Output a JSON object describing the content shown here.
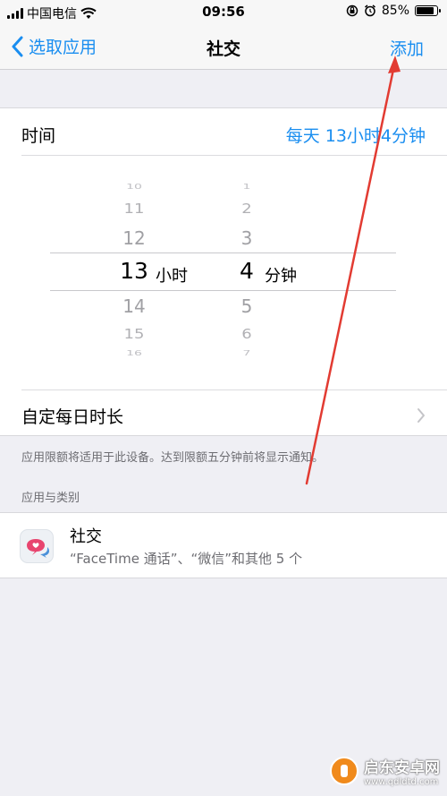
{
  "status_bar": {
    "carrier": "中国电信",
    "time": "09:56",
    "battery_text": "85%",
    "battery_level": 0.85
  },
  "nav": {
    "back_label": "选取应用",
    "title": "社交",
    "action_label": "添加"
  },
  "time_section": {
    "label": "时间",
    "value": "每天 13小时4分钟",
    "picker": {
      "hours": [
        "10",
        "11",
        "12",
        "13",
        "14",
        "15",
        "16"
      ],
      "minutes": [
        "1",
        "2",
        "3",
        "4",
        "5",
        "6",
        "7"
      ],
      "hour_unit": "小时",
      "minute_unit": "分钟"
    }
  },
  "custom_row": {
    "label": "自定每日时长"
  },
  "note": "应用限额将适用于此设备。达到限额五分钟前将显示通知。",
  "apps_section": {
    "header": "应用与类别",
    "item": {
      "title": "社交",
      "subtitle": "“FaceTime 通话”、“微信”和其他 5 个",
      "icon": "social-chat-icon"
    }
  },
  "colors": {
    "accent": "#1a8ef0",
    "annotation": "#e23b32",
    "icon_pink": "#e8456f",
    "icon_blue": "#4a90d9"
  },
  "watermark": {
    "title": "启东安卓网",
    "url": "www.qdldtd.com"
  }
}
